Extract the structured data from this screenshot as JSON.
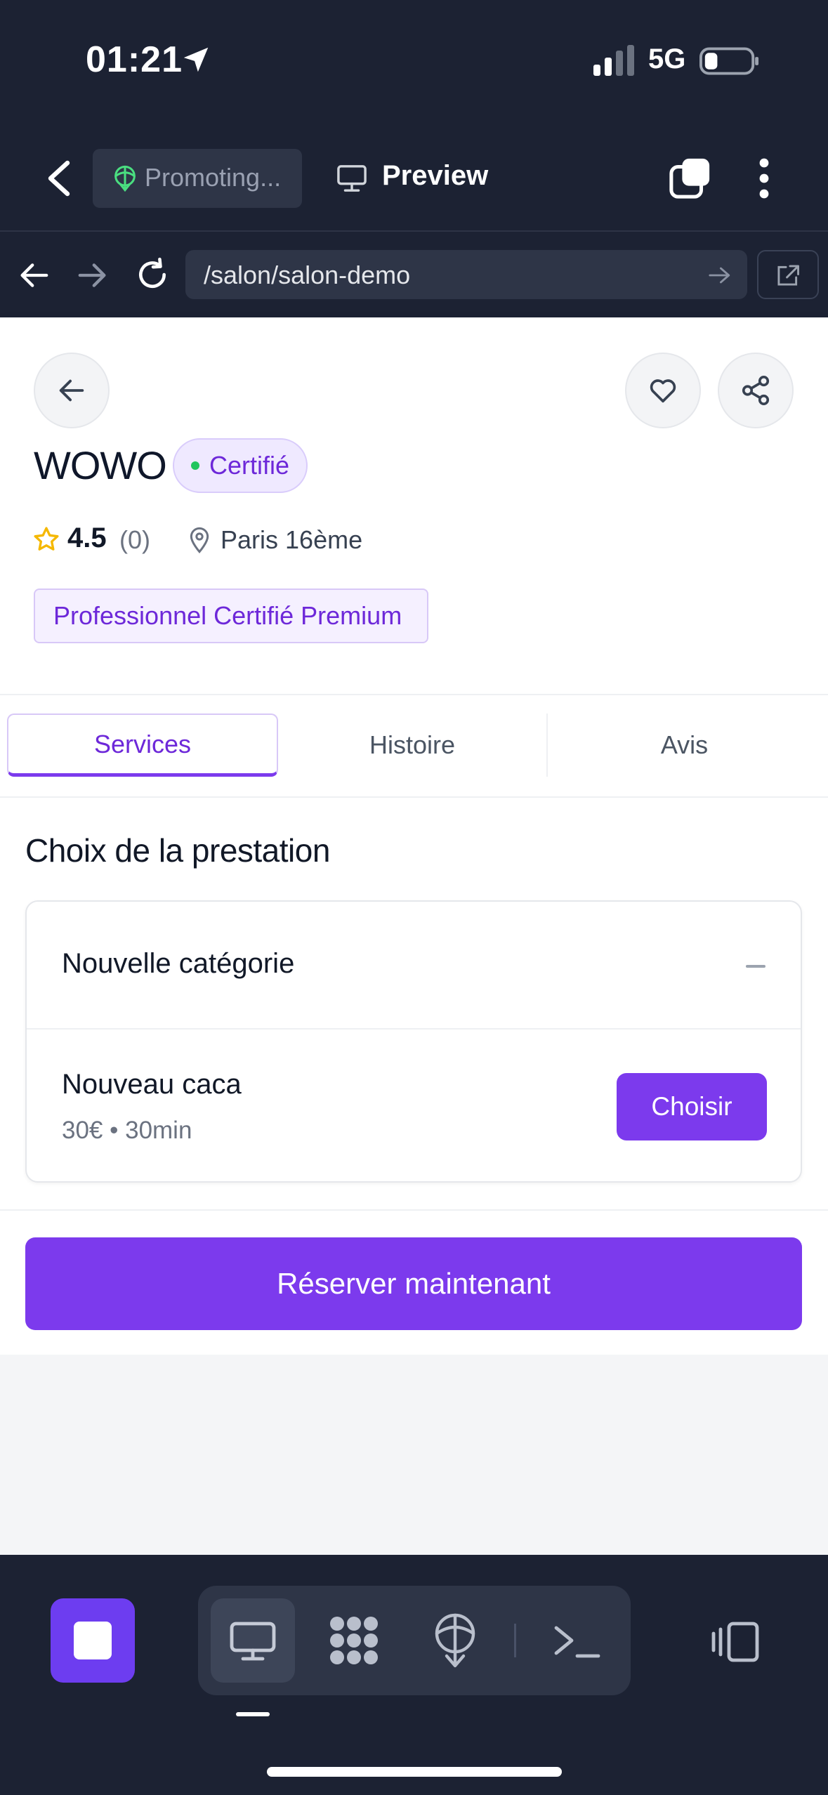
{
  "status_bar": {
    "time": "01:21",
    "network": "5G"
  },
  "toolbar": {
    "promo_label": "Promoting...",
    "preview_label": "Preview"
  },
  "url_bar": {
    "url": "/salon/salon-demo"
  },
  "salon": {
    "name": "WOWO",
    "certified_badge": "Certifié",
    "rating": "4.5",
    "reviews_count": "(0)",
    "location": "Paris 16ème",
    "premium_tag": "Professionnel Certifié Premium"
  },
  "tabs": [
    {
      "label": "Services",
      "active": true
    },
    {
      "label": "Histoire",
      "active": false
    },
    {
      "label": "Avis",
      "active": false
    }
  ],
  "services_section": {
    "title": "Choix de la prestation",
    "category": "Nouvelle catégorie",
    "items": [
      {
        "name": "Nouveau caca",
        "meta": "30€ • 30min",
        "button": "Choisir"
      }
    ]
  },
  "booking": {
    "button_label": "Réserver maintenant"
  },
  "colors": {
    "accent": "#7c3aed",
    "dark_bg": "#1c2233",
    "badge_green": "#22c55e",
    "star_yellow": "#f5b800"
  },
  "icons": {
    "status": [
      "location-arrow-icon",
      "signal-icon",
      "battery-icon"
    ],
    "toolbar": [
      "chevron-left-icon",
      "promote-icon",
      "monitor-icon",
      "tabs-icon",
      "more-vertical-icon"
    ],
    "url_bar": [
      "arrow-left-icon",
      "arrow-right-icon",
      "reload-icon",
      "go-arrow-icon",
      "external-link-icon"
    ],
    "page": [
      "back-arrow-icon",
      "heart-icon",
      "share-icon",
      "star-icon",
      "map-pin-icon",
      "collapse-icon"
    ],
    "dock": [
      "stop-icon",
      "desktop-icon",
      "cluster-icon",
      "globe-icon",
      "terminal-icon",
      "panel-icon"
    ]
  }
}
